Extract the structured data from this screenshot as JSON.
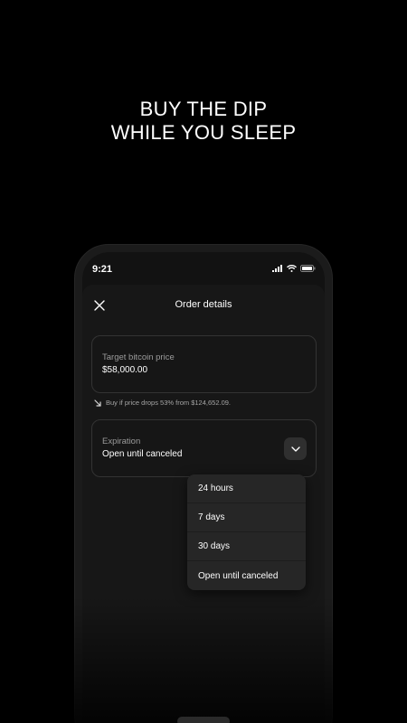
{
  "headline": {
    "line1": "BUY THE DIP",
    "line2": "WHILE YOU SLEEP"
  },
  "status_bar": {
    "time": "9:21",
    "icons": [
      "signal-icon",
      "wifi-icon",
      "battery-icon"
    ]
  },
  "order_sheet": {
    "title": "Order details",
    "close_icon": "close-icon",
    "target_price": {
      "label": "Target bitcoin price",
      "value": "$58,000.00"
    },
    "hint": {
      "icon": "trend-down-arrow-icon",
      "text": "Buy if price drops 53% from $124,652.09."
    },
    "expiration": {
      "label": "Expiration",
      "value": "Open until canceled",
      "dropdown_icon": "chevron-down-icon"
    },
    "expiration_options": [
      "24 hours",
      "7 days",
      "30 days",
      "Open until canceled"
    ]
  },
  "colors": {
    "background": "#000000",
    "sheet": "#171717",
    "menu": "#262626",
    "muted_text": "#9b9b9b"
  }
}
